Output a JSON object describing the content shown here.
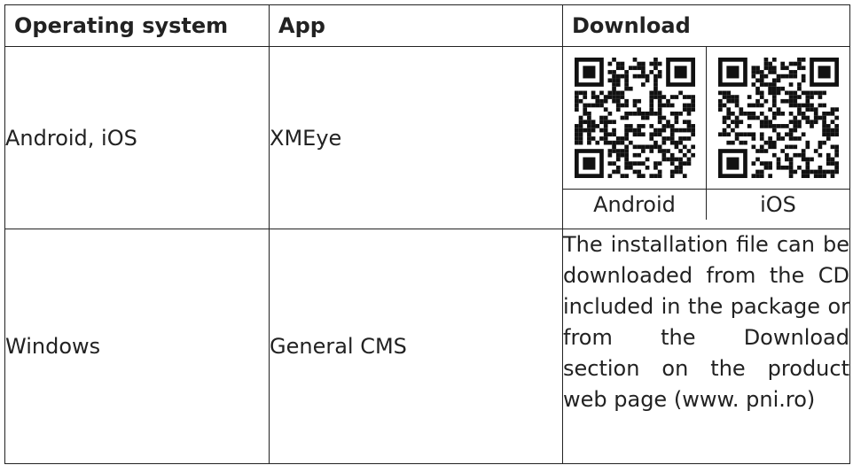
{
  "table": {
    "headers": [
      "Operating system",
      "App",
      "Download"
    ],
    "rows": [
      {
        "os": "Android, iOS",
        "app": "XMEye",
        "download": {
          "qr_codes": [
            {
              "label": "Android",
              "icon": "qr-code-icon"
            },
            {
              "label": "iOS",
              "icon": "qr-code-icon"
            }
          ]
        }
      },
      {
        "os": "Windows",
        "app": "General CMS",
        "download_text": "The installation file can be downloaded from the CD included in the package or from the Download section on the product web page (www. pni.ro)"
      }
    ]
  }
}
